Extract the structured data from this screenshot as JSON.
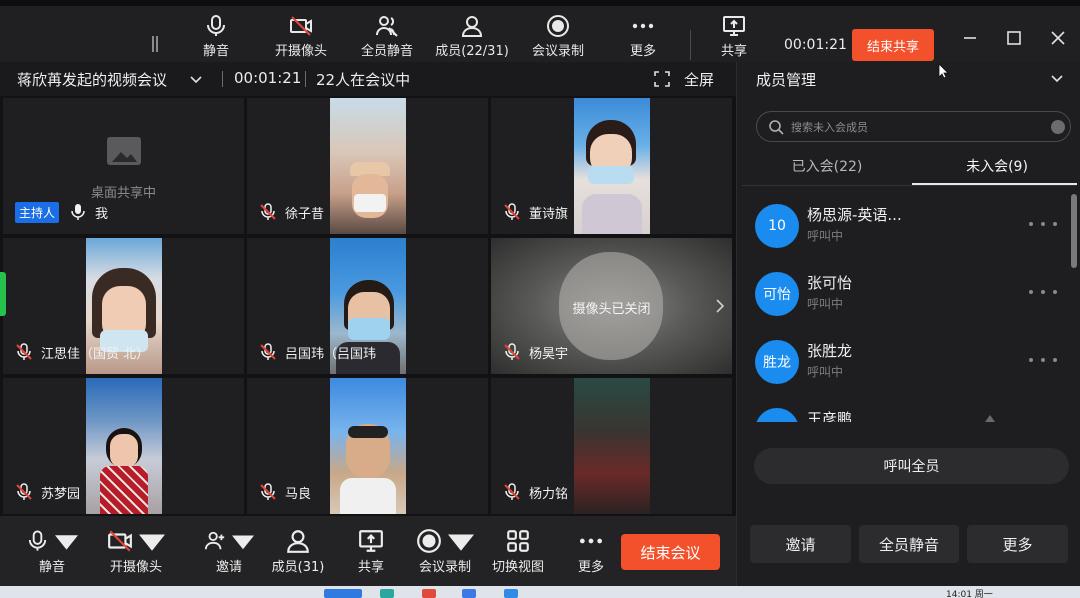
{
  "top_toolbar": {
    "mute": "静音",
    "camera": "开摄像头",
    "mute_all": "全员静音",
    "members": "成员(22/31)",
    "record": "会议录制",
    "more": "更多",
    "share": "共享",
    "timer": "00:01:21",
    "end_share": "结束共享"
  },
  "info_bar": {
    "meeting_title": "蒋欣苒发起的视频会议",
    "timer": "00:01:21",
    "count": "22人在会议中",
    "fullscreen": "全屏"
  },
  "tiles": [
    {
      "name": "我",
      "host_badge": "主持人",
      "note": "桌面共享中"
    },
    {
      "name": "徐子昔"
    },
    {
      "name": "董诗旗"
    },
    {
      "name": "江思佳（国贸 北）"
    },
    {
      "name": "吕国玮（吕国玮"
    },
    {
      "name": "杨昊宇",
      "note": "摄像头已关闭"
    },
    {
      "name": "苏梦园"
    },
    {
      "name": "马良"
    },
    {
      "name": "杨力铭"
    }
  ],
  "bottom_toolbar": {
    "mute": "静音",
    "camera": "开摄像头",
    "invite": "邀请",
    "members": "成员(31)",
    "share": "共享",
    "record": "会议录制",
    "switch_view": "切换视图",
    "more": "更多",
    "end_meeting": "结束会议"
  },
  "panel": {
    "title": "成员管理",
    "search_placeholder": "搜索未入会成员",
    "tab_joined": "已入会(22)",
    "tab_not_joined": "未入会(9)",
    "members": [
      {
        "avatar": "10",
        "name": "杨思源-英语...",
        "status": "呼叫中"
      },
      {
        "avatar": "可怡",
        "name": "张可怡",
        "status": "呼叫中"
      },
      {
        "avatar": "胜龙",
        "name": "张胜龙",
        "status": "呼叫中"
      },
      {
        "avatar": "",
        "name": "王彦鹏",
        "status": ""
      }
    ],
    "call_all": "呼叫全员",
    "invite": "邀请",
    "mute_all": "全员静音",
    "more": "更多"
  },
  "taskbar": {
    "time": "14:01 周一"
  },
  "colors": {
    "accent_red": "#f3512c",
    "avatar_blue": "#1a8cf0",
    "host_blue": "#1b6ee6",
    "mic_muted_red": "#e4453a"
  }
}
